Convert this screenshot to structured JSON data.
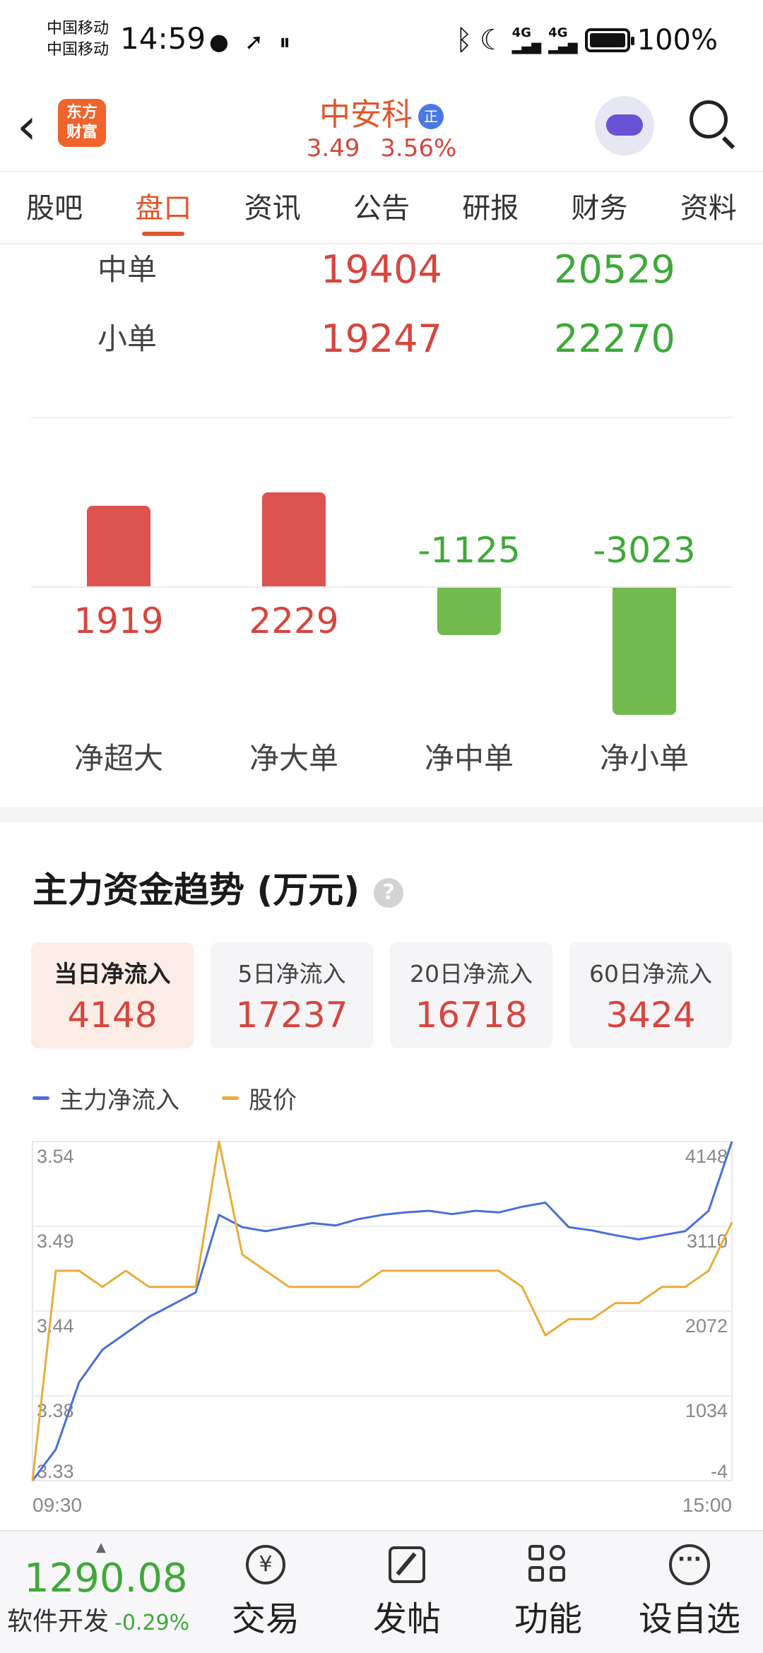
{
  "status_bar": {
    "carrier1": "中国移动",
    "carrier2": "中国移动",
    "time": "14:59",
    "network1": "4G",
    "network2": "4G",
    "battery": "100%",
    "icons": [
      "wechat-icon",
      "send-icon",
      "pause-icon",
      "bluetooth-icon",
      "moon-icon"
    ]
  },
  "header": {
    "logo_line1": "东方",
    "logo_line2": "财富",
    "stock_name": "中安科",
    "tag": "正",
    "price": "3.49",
    "change_pct": "3.56%"
  },
  "tabs": [
    "股吧",
    "盘口",
    "资讯",
    "公告",
    "研报",
    "财务",
    "资料"
  ],
  "active_tab": "盘口",
  "orders": [
    {
      "label": "中单",
      "inflow": "19404",
      "outflow": "20529"
    },
    {
      "label": "小单",
      "inflow": "19247",
      "outflow": "22270"
    }
  ],
  "net_flow_chart": {
    "type": "bar",
    "categories": [
      "净超大",
      "净大单",
      "净中单",
      "净小单"
    ],
    "values": [
      1919,
      2229,
      -1125,
      -3023
    ],
    "value_labels": [
      "1919",
      "2229",
      "-1125",
      "-3023"
    ],
    "colors": {
      "positive": "#dd5350",
      "negative": "#72ba50"
    }
  },
  "trend": {
    "title": "主力资金趋势 (万元)",
    "help": "?",
    "cards": [
      {
        "title": "当日净流入",
        "value": "4148"
      },
      {
        "title": "5日净流入",
        "value": "17237"
      },
      {
        "title": "20日净流入",
        "value": "16718"
      },
      {
        "title": "60日净流入",
        "value": "3424"
      }
    ],
    "legend": [
      {
        "name": "主力净流入",
        "color": "#4a6fd6"
      },
      {
        "name": "股价",
        "color": "#e8ad3a"
      }
    ]
  },
  "chart_data": {
    "type": "line",
    "x_start_label": "09:30",
    "x_end_label": "15:00",
    "y_left_ticks": [
      "3.54",
      "3.49",
      "3.44",
      "3.38",
      "3.33"
    ],
    "y_right_ticks": [
      "4148",
      "3110",
      "2072",
      "1034",
      "-4"
    ],
    "ylim_left": [
      3.33,
      3.54
    ],
    "ylim_right": [
      -4,
      4148
    ],
    "x": [
      0,
      8,
      16,
      24,
      32,
      40,
      48,
      56,
      64,
      72,
      80,
      88,
      96,
      104,
      112,
      120,
      128,
      136,
      144,
      152,
      160,
      168,
      176,
      184,
      192,
      200,
      208,
      216,
      224,
      232,
      240
    ],
    "series": [
      {
        "name": "主力净流入",
        "axis": "right",
        "values": [
          -4,
          380,
          1200,
          1600,
          1800,
          2000,
          2150,
          2300,
          3250,
          3100,
          3050,
          3100,
          3150,
          3120,
          3200,
          3250,
          3280,
          3300,
          3260,
          3300,
          3280,
          3350,
          3400,
          3100,
          3060,
          3000,
          2950,
          3000,
          3050,
          3300,
          4148
        ]
      },
      {
        "name": "股价",
        "axis": "left",
        "values": [
          3.33,
          3.46,
          3.46,
          3.45,
          3.46,
          3.45,
          3.45,
          3.45,
          3.54,
          3.47,
          3.46,
          3.45,
          3.45,
          3.45,
          3.45,
          3.46,
          3.46,
          3.46,
          3.46,
          3.46,
          3.46,
          3.45,
          3.42,
          3.43,
          3.43,
          3.44,
          3.44,
          3.45,
          3.45,
          3.46,
          3.49
        ]
      }
    ],
    "grid": true,
    "legend": "top-left"
  },
  "bottom": {
    "index_value": "1290.08",
    "index_name": "软件开发",
    "index_change": "-0.29%",
    "nav": [
      {
        "label": "交易",
        "icon": "yuan-icon"
      },
      {
        "label": "发帖",
        "icon": "edit-icon"
      },
      {
        "label": "功能",
        "icon": "grid-icon"
      },
      {
        "label": "设自选",
        "icon": "more-icon"
      }
    ]
  }
}
